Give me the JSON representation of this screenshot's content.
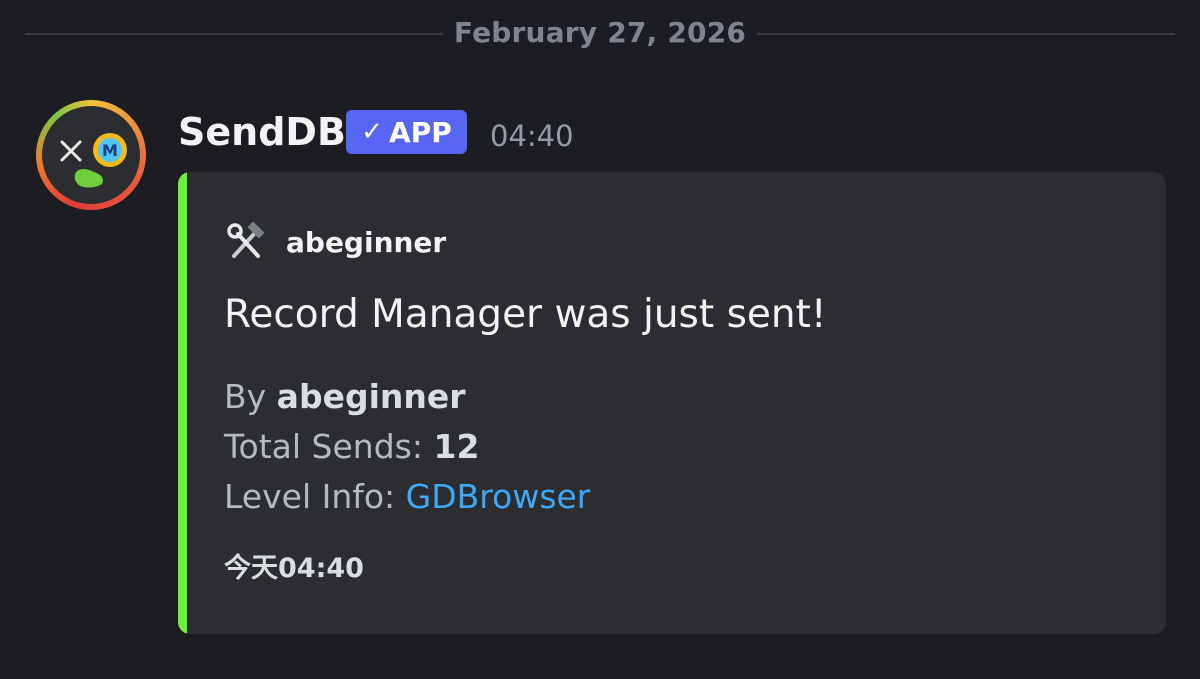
{
  "divider": {
    "date": "February 27, 2026"
  },
  "message": {
    "author": "SendDB",
    "badge_check": "✓",
    "badge_label": "APP",
    "timestamp": "04:40",
    "avatar_icon": "tools-and-moderator-badge-icon"
  },
  "embed": {
    "accent_color": "#6df23a",
    "author_name": "abeginner",
    "author_icon": "hammer-and-wrench-icon",
    "title": "Record Manager was just sent!",
    "fields": {
      "by_label": "By ",
      "by_value": "abeginner",
      "sends_label": "Total Sends: ",
      "sends_value": "12",
      "level_label": "Level Info: ",
      "level_link": "GDBrowser"
    },
    "footer": "今天04:40"
  },
  "colors": {
    "background": "#1c1d22",
    "embed_background": "#2b2d31",
    "badge": "#5865f2",
    "link": "#3ea8f5"
  }
}
